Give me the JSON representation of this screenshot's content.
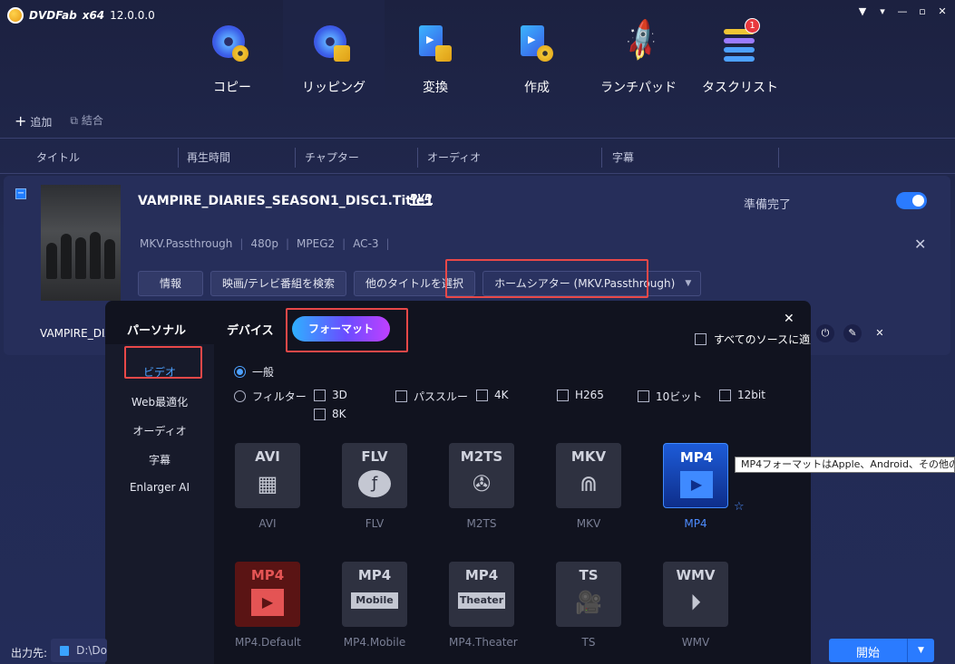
{
  "app": {
    "brand": "DVDFab",
    "edition": "x64",
    "version": "12.0.0.0",
    "window_controls": [
      "shirt-icon",
      "minimize-icon",
      "dropdown-icon",
      "restore-icon",
      "close-icon"
    ]
  },
  "nav": {
    "items": [
      {
        "label": "コピー",
        "icon": "copy-disc-icon"
      },
      {
        "label": "リッピング",
        "icon": "ripper-disc-icon"
      },
      {
        "label": "変換",
        "icon": "converter-film-icon"
      },
      {
        "label": "作成",
        "icon": "creator-film-icon"
      },
      {
        "label": "ランチパッド",
        "icon": "rocket-icon"
      },
      {
        "label": "タスクリスト",
        "icon": "tasklist-icon",
        "badge": "1"
      }
    ],
    "active_index": 1
  },
  "toolbar": {
    "add": "追加",
    "combine": "結合"
  },
  "columns": [
    "タイトル",
    "再生時間",
    "チャプター",
    "オーディオ",
    "字幕"
  ],
  "source": {
    "title": "VAMPIRE_DIARIES_SEASON1_DISC1.Title1",
    "disc_badge": "DVD",
    "status": "準備完了",
    "meta": [
      "MKV.Passthrough",
      "480p",
      "MPEG2",
      "AC-3"
    ],
    "buttons": {
      "info": "情報",
      "search": "映画/テレビ番組を検索",
      "other_title": "他のタイトルを選択",
      "profile": "ホームシアター (MKV.Passthrough)"
    },
    "subrow_title": "VAMPIRE_DIA"
  },
  "panel": {
    "side_title": "パーソナル",
    "side_items": [
      "ビデオ",
      "Web最適化",
      "オーディオ",
      "字幕",
      "Enlarger AI"
    ],
    "tab_device": "デバイス",
    "tab_format": "フォーマット",
    "apply_all": "すべてのソースに適用",
    "general": "一般",
    "filter": "フィルター",
    "filters": [
      "3D",
      "パススルー",
      "4K",
      "H265",
      "10ビット",
      "12bit",
      "8K"
    ],
    "formats": [
      {
        "name": "AVI",
        "label": "AVI",
        "glyph": "film-strip"
      },
      {
        "name": "FLV",
        "label": "FLV",
        "glyph": "flash"
      },
      {
        "name": "M2TS",
        "label": "M2TS",
        "glyph": "reel"
      },
      {
        "name": "MKV",
        "label": "MKV",
        "glyph": "mkv"
      },
      {
        "name": "MP4",
        "label": "MP4",
        "glyph": "play",
        "selected": true
      },
      {
        "name": "MP4",
        "label": "MP4.Default",
        "glyph": "play",
        "style": "red"
      },
      {
        "name": "MP4",
        "label": "MP4.Mobile",
        "banner": "Mobile"
      },
      {
        "name": "MP4",
        "label": "MP4.Theater",
        "banner": "Theater"
      },
      {
        "name": "TS",
        "label": "TS",
        "glyph": "camera"
      },
      {
        "name": "WMV",
        "label": "WMV",
        "glyph": "play-circle"
      }
    ],
    "tooltip": "MP4フォーマットはApple、Android、その他のデバイ"
  },
  "bottom": {
    "output_label": "出力先:",
    "output_path": "D:\\Do",
    "start": "開始"
  },
  "colors": {
    "accent": "#2a7bff",
    "highlight_box": "#e84848",
    "badge": "#e8383d"
  }
}
